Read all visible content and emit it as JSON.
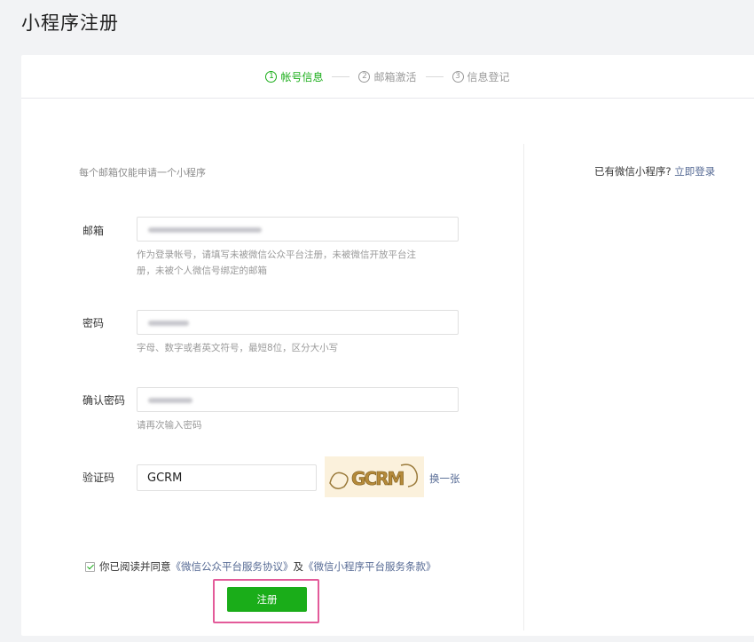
{
  "page_title": "小程序注册",
  "steps": [
    {
      "num": "1",
      "label": "帐号信息",
      "active": true
    },
    {
      "num": "2",
      "label": "邮箱激活",
      "active": false
    },
    {
      "num": "3",
      "label": "信息登记",
      "active": false
    }
  ],
  "notice": "每个邮箱仅能申请一个小程序",
  "login_hint": {
    "text": "已有微信小程序?",
    "link": "立即登录"
  },
  "form": {
    "email": {
      "label": "邮箱",
      "hint_line1": "作为登录帐号，请填写未被微信公众平台注册，未被微信开放平台注",
      "hint_line2": "册，未被个人微信号绑定的邮箱"
    },
    "password": {
      "label": "密码",
      "hint": "字母、数字或者英文符号，最短8位，区分大小写"
    },
    "confirm_password": {
      "label": "确认密码",
      "hint": "请再次输入密码"
    },
    "captcha": {
      "label": "验证码",
      "value": "GCRM",
      "image_text": "GCRM",
      "refresh": "换一张"
    }
  },
  "agreement": {
    "prefix": "你已阅读并同意",
    "link1": "《微信公众平台服务协议》",
    "middle": "及",
    "link2": "《微信小程序平台服务条款》",
    "checked": true
  },
  "submit_label": "注册",
  "colors": {
    "accent": "#1aad19",
    "link": "#576b95",
    "highlight": "#e35b9a"
  }
}
